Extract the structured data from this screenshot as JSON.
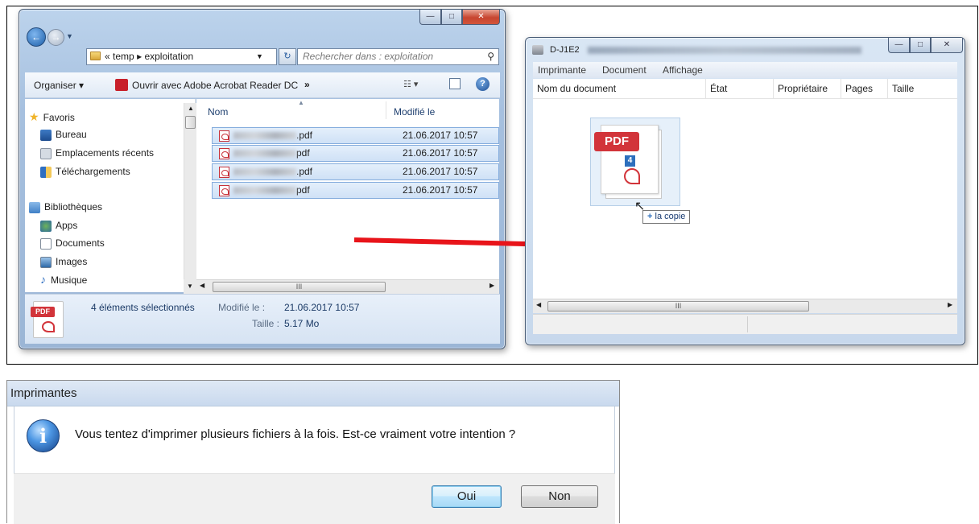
{
  "explorer": {
    "breadcrumb_prefix": "«",
    "breadcrumb": [
      "temp",
      "exploitation"
    ],
    "search_placeholder": "Rechercher dans : exploitation",
    "toolbar": {
      "organize": "Organiser",
      "open_with": "Ouvrir avec Adobe Acrobat Reader DC",
      "more": "»"
    },
    "nav": {
      "favorites": "Favoris",
      "favorites_items": [
        "Bureau",
        "Emplacements récents",
        "Téléchargements"
      ],
      "libraries": "Bibliothèques",
      "libraries_items": [
        "Apps",
        "Documents",
        "Images",
        "Musique"
      ]
    },
    "columns": {
      "name": "Nom",
      "modified": "Modifié le"
    },
    "files": [
      {
        "suffix": ".pdf",
        "date": "21.06.2017 10:57"
      },
      {
        "suffix": "pdf",
        "date": "21.06.2017 10:57"
      },
      {
        "suffix": ".pdf",
        "date": "21.06.2017 10:57"
      },
      {
        "suffix": "pdf",
        "date": "21.06.2017 10:57"
      }
    ],
    "scroll_grip": "III",
    "details": {
      "selected": "4 éléments sélectionnés",
      "modified_label": "Modifié le :",
      "modified_value": "21.06.2017 10:57",
      "size_label": "Taille :",
      "size_value": "5.17 Mo",
      "pdf_badge": "PDF"
    }
  },
  "printer": {
    "title": "D-J1E2",
    "menu": [
      "Imprimante",
      "Document",
      "Affichage"
    ],
    "columns": [
      "Nom du document",
      "État",
      "Propriétaire",
      "Pages",
      "Taille"
    ],
    "drag": {
      "pdf_badge": "PDF",
      "count": "4",
      "tooltip": "la copie"
    },
    "scroll_grip": "III"
  },
  "dialog": {
    "title": "Imprimantes",
    "message": "Vous tentez d'imprimer plusieurs fichiers à la fois. Est-ce vraiment votre intention ?",
    "yes": "Oui",
    "no": "Non"
  },
  "colors": {
    "arrow": "#e8141a",
    "selection": "#cfe1f6",
    "pdf_red": "#d2343a"
  }
}
